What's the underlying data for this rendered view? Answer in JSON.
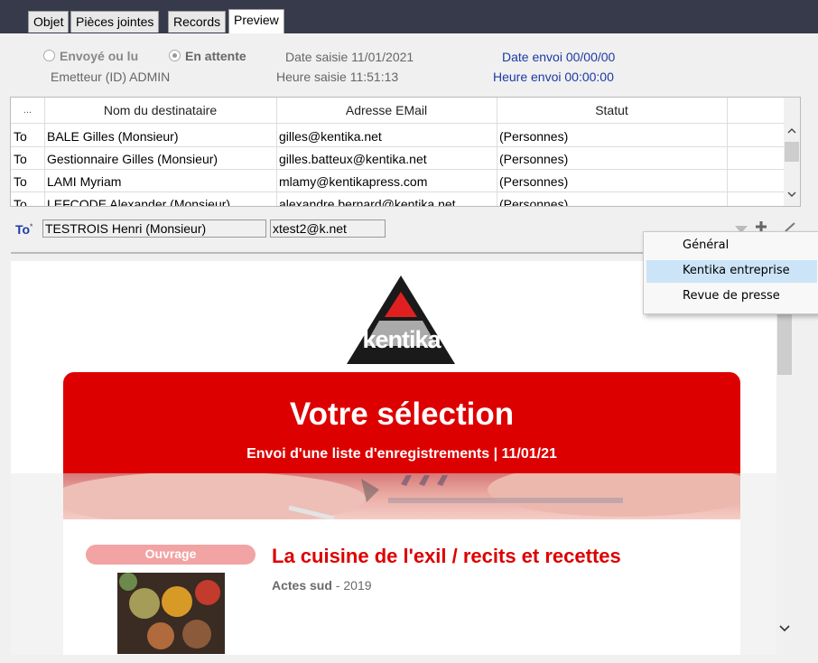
{
  "tabs": [
    "Objet",
    "Pièces jointes",
    "Records",
    "Preview"
  ],
  "status": {
    "sent_label": "Envoyé ou lu",
    "pending_label": "En attente",
    "sender": "Emetteur (ID) ADMIN",
    "date_saisie": "Date saisie  11/01/2021",
    "heure_saisie": "Heure saisie  11:51:13",
    "date_envoi": "Date envoi  00/00/00",
    "heure_envoi": "Heure envoi  00:00:00"
  },
  "recipients": {
    "columns": [
      "...",
      "Nom du destinataire",
      "Adresse EMail",
      "Statut"
    ],
    "rows": [
      {
        "type": "To",
        "name": "BALE Gilles (Monsieur)",
        "email": "gilles@kentika.net",
        "status": "(Personnes)"
      },
      {
        "type": "To",
        "name": "Gestionnaire Gilles (Monsieur)",
        "email": "gilles.batteux@kentika.net",
        "status": "(Personnes)"
      },
      {
        "type": "To",
        "name": "LAMI Myriam",
        "email": "mlamy@kentikapress.com",
        "status": "(Personnes)"
      },
      {
        "type": "To",
        "name": "LEFCODE Alexander (Monsieur)",
        "email": "alexandre.bernard@kentika.net",
        "status": "(Personnes)"
      }
    ]
  },
  "editor": {
    "type_label": "To",
    "name_value": "TESTROIS Henri (Monsieur)",
    "email_value": "xtest2@k.net"
  },
  "dropdown": {
    "items": [
      "Général",
      "Kentika entreprise",
      "Revue de presse"
    ],
    "selected_index": 1
  },
  "preview": {
    "logo_text": "kentika",
    "banner_title": "Votre sélection",
    "banner_subtitle": "Envoi d'une liste d'enregistrements | 11/01/21",
    "record": {
      "badge": "Ouvrage",
      "title": "La cuisine de l'exil / recits et recettes",
      "publisher": "Actes sud",
      "separator": " - ",
      "year": "2019"
    }
  },
  "colors": {
    "topbar": "#363a4b",
    "brand_red": "#dd0000",
    "badge_pink": "#f2a3a3",
    "link_blue": "#1b3aa6",
    "menu_highlight": "#cce4f7"
  }
}
